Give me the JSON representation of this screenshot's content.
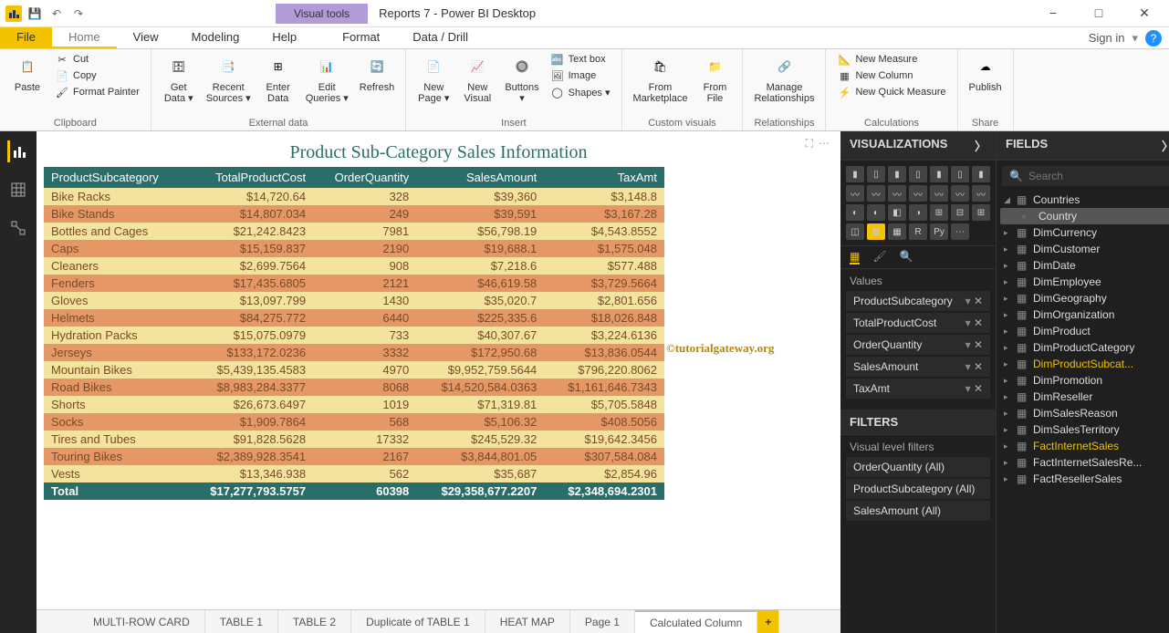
{
  "window": {
    "title": "Reports 7 - Power BI Desktop",
    "visual_tools": "Visual tools",
    "sign_in": "Sign in",
    "minimize": "−",
    "maximize": "□",
    "close": "✕"
  },
  "ribbon_tabs": {
    "file": "File",
    "home": "Home",
    "view": "View",
    "modeling": "Modeling",
    "help": "Help",
    "format": "Format",
    "data_drill": "Data / Drill"
  },
  "help_tip": "?",
  "ribbon": {
    "clipboard": {
      "label": "Clipboard",
      "paste": "Paste",
      "cut": "Cut",
      "copy": "Copy",
      "format_painter": "Format Painter"
    },
    "external": {
      "label": "External data",
      "get_data": "Get\nData ▾",
      "recent": "Recent\nSources ▾",
      "enter": "Enter\nData",
      "edit": "Edit\nQueries ▾",
      "refresh": "Refresh"
    },
    "insert": {
      "label": "Insert",
      "new_page": "New\nPage ▾",
      "new_visual": "New\nVisual",
      "buttons": "Buttons\n▾",
      "text_box": "Text box",
      "image": "Image",
      "shapes": "Shapes ▾"
    },
    "custom": {
      "label": "Custom visuals",
      "marketplace": "From\nMarketplace",
      "file": "From\nFile"
    },
    "relationships": {
      "label": "Relationships",
      "manage": "Manage\nRelationships"
    },
    "calc": {
      "label": "Calculations",
      "measure": "New Measure",
      "column": "New Column",
      "quick": "New Quick Measure"
    },
    "share": {
      "label": "Share",
      "publish": "Publish"
    }
  },
  "report": {
    "title": "Product Sub-Category Sales Information",
    "headers": [
      "ProductSubcategory",
      "TotalProductCost",
      "OrderQuantity",
      "SalesAmount",
      "TaxAmt"
    ],
    "rows": [
      [
        "Bike Racks",
        "$14,720.64",
        "328",
        "$39,360",
        "$3,148.8"
      ],
      [
        "Bike Stands",
        "$14,807.034",
        "249",
        "$39,591",
        "$3,167.28"
      ],
      [
        "Bottles and Cages",
        "$21,242.8423",
        "7981",
        "$56,798.19",
        "$4,543.8552"
      ],
      [
        "Caps",
        "$15,159.837",
        "2190",
        "$19,688.1",
        "$1,575.048"
      ],
      [
        "Cleaners",
        "$2,699.7564",
        "908",
        "$7,218.6",
        "$577.488"
      ],
      [
        "Fenders",
        "$17,435.6805",
        "2121",
        "$46,619.58",
        "$3,729.5664"
      ],
      [
        "Gloves",
        "$13,097.799",
        "1430",
        "$35,020.7",
        "$2,801.656"
      ],
      [
        "Helmets",
        "$84,275.772",
        "6440",
        "$225,335.6",
        "$18,026.848"
      ],
      [
        "Hydration Packs",
        "$15,075.0979",
        "733",
        "$40,307.67",
        "$3,224.6136"
      ],
      [
        "Jerseys",
        "$133,172.0236",
        "3332",
        "$172,950.68",
        "$13,836.0544"
      ],
      [
        "Mountain Bikes",
        "$5,439,135.4583",
        "4970",
        "$9,952,759.5644",
        "$796,220.8062"
      ],
      [
        "Road Bikes",
        "$8,983,284.3377",
        "8068",
        "$14,520,584.0363",
        "$1,161,646.7343"
      ],
      [
        "Shorts",
        "$26,673.6497",
        "1019",
        "$71,319.81",
        "$5,705.5848"
      ],
      [
        "Socks",
        "$1,909.7864",
        "568",
        "$5,106.32",
        "$408.5056"
      ],
      [
        "Tires and Tubes",
        "$91,828.5628",
        "17332",
        "$245,529.32",
        "$19,642.3456"
      ],
      [
        "Touring Bikes",
        "$2,389,928.3541",
        "2167",
        "$3,844,801.05",
        "$307,584.084"
      ],
      [
        "Vests",
        "$13,346.938",
        "562",
        "$35,687",
        "$2,854.96"
      ]
    ],
    "total": [
      "Total",
      "$17,277,793.5757",
      "60398",
      "$29,358,677.2207",
      "$2,348,694.2301"
    ],
    "watermark": "©tutorialgateway.org"
  },
  "viz": {
    "header": "VISUALIZATIONS",
    "values_label": "Values",
    "filters_label": "FILTERS",
    "visual_filters": "Visual level filters",
    "values": [
      "ProductSubcategory",
      "TotalProductCost",
      "OrderQuantity",
      "SalesAmount",
      "TaxAmt"
    ],
    "filters": [
      "OrderQuantity (All)",
      "ProductSubcategory (All)",
      "SalesAmount (All)"
    ]
  },
  "fields": {
    "header": "FIELDS",
    "search": "Search",
    "tables": [
      {
        "name": "Countries",
        "expanded": true,
        "children": [
          "Country"
        ]
      },
      {
        "name": "DimCurrency"
      },
      {
        "name": "DimCustomer"
      },
      {
        "name": "DimDate"
      },
      {
        "name": "DimEmployee"
      },
      {
        "name": "DimGeography"
      },
      {
        "name": "DimOrganization"
      },
      {
        "name": "DimProduct"
      },
      {
        "name": "DimProductCategory"
      },
      {
        "name": "DimProductSubcat...",
        "gold": true
      },
      {
        "name": "DimPromotion"
      },
      {
        "name": "DimReseller"
      },
      {
        "name": "DimSalesReason"
      },
      {
        "name": "DimSalesTerritory"
      },
      {
        "name": "FactInternetSales",
        "gold": true
      },
      {
        "name": "FactInternetSalesRe..."
      },
      {
        "name": "FactResellerSales"
      }
    ]
  },
  "pages": [
    "MULTI-ROW CARD",
    "TABLE 1",
    "TABLE 2",
    "Duplicate of TABLE 1",
    "HEAT MAP",
    "Page 1",
    "Calculated Column"
  ]
}
